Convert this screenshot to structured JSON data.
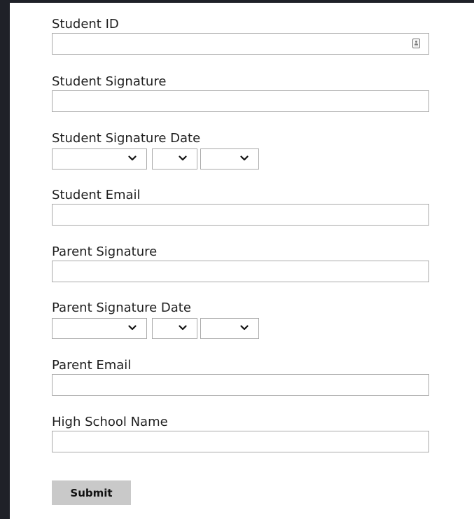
{
  "form": {
    "student_id": {
      "label": "Student ID",
      "value": ""
    },
    "student_signature": {
      "label": "Student Signature",
      "value": ""
    },
    "student_signature_date": {
      "label": "Student Signature Date",
      "month": "",
      "day": "",
      "year": ""
    },
    "student_email": {
      "label": "Student Email",
      "value": ""
    },
    "parent_signature": {
      "label": "Parent Signature",
      "value": ""
    },
    "parent_signature_date": {
      "label": "Parent Signature Date",
      "month": "",
      "day": "",
      "year": ""
    },
    "parent_email": {
      "label": "Parent Email",
      "value": ""
    },
    "high_school_name": {
      "label": "High School Name",
      "value": ""
    },
    "submit_label": "Submit"
  },
  "icons": {
    "student_id_field_icon": "contact-card-icon",
    "select_arrow": "chevron-down-icon"
  },
  "colors": {
    "page_background": "#1f2128",
    "form_background": "#ffffff",
    "input_border": "#a9a9a9",
    "submit_background": "#c9c9c9",
    "text": "#1e1e1e"
  }
}
